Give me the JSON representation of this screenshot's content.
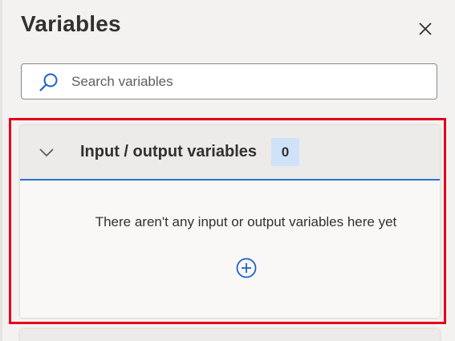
{
  "panel": {
    "title": "Variables",
    "close_icon": "close-icon"
  },
  "search": {
    "placeholder": "Search variables",
    "value": "",
    "icon": "search-icon"
  },
  "section": {
    "title": "Input / output variables",
    "count": "0",
    "expanded": true,
    "chevron_icon": "chevron-down-icon",
    "empty_message": "There aren't any input or output variables here yet",
    "add_icon": "add-circle-icon"
  },
  "colors": {
    "accent": "#2b6fd6",
    "badge_bg": "#cfe2f8",
    "highlight_border": "#e3001b",
    "panel_bg": "#f3f2f1"
  }
}
